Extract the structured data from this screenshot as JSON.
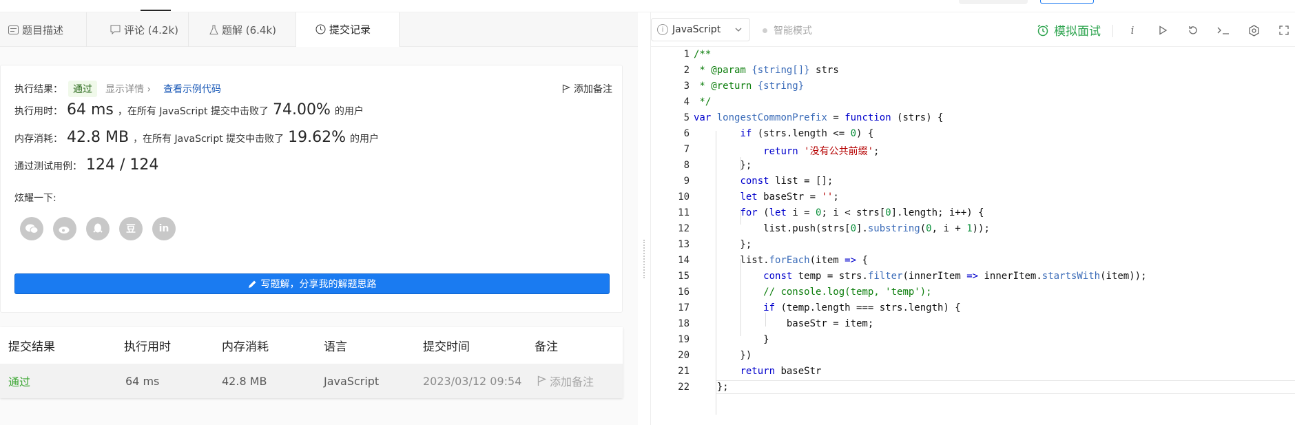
{
  "tabs": [
    {
      "label": "题目描述",
      "icon": "description-icon"
    },
    {
      "label": "评论 (4.2k)",
      "icon": "comment-icon"
    },
    {
      "label": "题解 (6.4k)",
      "icon": "flask-icon"
    },
    {
      "label": "提交记录",
      "icon": "clock-icon",
      "active": true
    }
  ],
  "result": {
    "label": "执行结果：",
    "status": "通过",
    "detail": "显示详情 ›",
    "sample_link": "查看示例代码",
    "add_note": "添加备注"
  },
  "runtime": {
    "label": "执行用时：",
    "value": "64 ms",
    "mid": "，在所有 JavaScript 提交中击败了",
    "percent": "74.00%",
    "suffix": "的用户"
  },
  "memory": {
    "label": "内存消耗：",
    "value": "42.8 MB",
    "mid": "，在所有 JavaScript 提交中击败了",
    "percent": "19.62%",
    "suffix": "的用户"
  },
  "tests": {
    "label": "通过测试用例：",
    "value": "124 / 124"
  },
  "share": {
    "label": "炫耀一下:",
    "icons": [
      "wechat-icon",
      "weibo-icon",
      "qq-icon",
      "douban-icon",
      "linkedin-icon"
    ],
    "glyphs": [
      "",
      "",
      "",
      "豆",
      "in"
    ]
  },
  "write_button": "写题解，分享我的解题思路",
  "table": {
    "headers": [
      "提交结果",
      "执行用时",
      "内存消耗",
      "语言",
      "提交时间",
      "备注"
    ],
    "rows": [
      {
        "result": "通过",
        "time": "64 ms",
        "memory": "42.8 MB",
        "language": "JavaScript",
        "submitted": "2023/03/12 09:54",
        "note": "添加备注"
      }
    ]
  },
  "editor": {
    "language": "JavaScript",
    "smart_mode": "智能模式",
    "mock_interview": "模拟面试",
    "tool_icons": [
      "info-icon",
      "run-icon",
      "reset-icon",
      "console-icon",
      "settings-icon",
      "fullscreen-icon"
    ],
    "line_numbers": [
      "1",
      "2",
      "3",
      "4",
      "5",
      "6",
      "7",
      "8",
      "9",
      "10",
      "11",
      "12",
      "13",
      "14",
      "15",
      "16",
      "17",
      "18",
      "19",
      "20",
      "21",
      "22"
    ]
  },
  "colors": {
    "accent_blue": "#1a7bf1",
    "pass_green": "#3fa836",
    "mock_green": "#2ea44f"
  }
}
